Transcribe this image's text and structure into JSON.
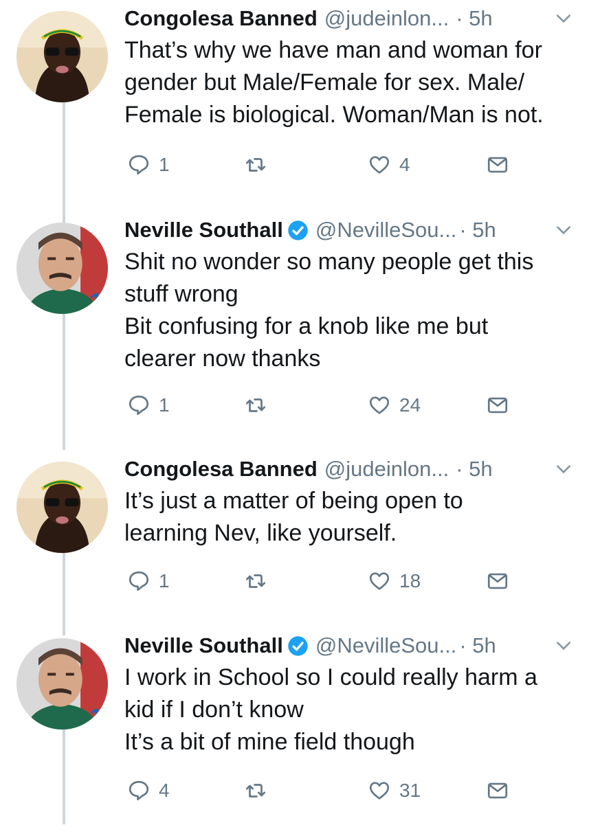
{
  "tweets": [
    {
      "display_name": "Congolesa Banned",
      "handle": "@judeinlon...",
      "time": "· 5h",
      "verified": false,
      "text_lines": [
        "That’s why we have man and woman for",
        "gender but Male/Female for sex. Male/",
        "Female is biological. Woman/Man is not."
      ],
      "reply_count": "1",
      "retweet_count": "",
      "like_count": "4"
    },
    {
      "display_name": "Neville Southall",
      "handle": "@NevilleSou...",
      "time": "· 5h",
      "verified": true,
      "text_lines": [
        "Shit no wonder so many people get this",
        "stuff wrong",
        "Bit confusing for a knob like me but",
        "clearer now thanks"
      ],
      "reply_count": "1",
      "retweet_count": "",
      "like_count": "24"
    },
    {
      "display_name": "Congolesa Banned",
      "handle": "@judeinlon...",
      "time": "· 5h",
      "verified": false,
      "text_lines": [
        "It’s just a matter of being open to",
        "learning Nev, like yourself."
      ],
      "reply_count": "1",
      "retweet_count": "",
      "like_count": "18"
    },
    {
      "display_name": "Neville Southall",
      "handle": "@NevilleSou...",
      "time": "· 5h",
      "verified": true,
      "text_lines": [
        "I work in School so I could really harm a",
        "kid if I don’t know",
        "It’s a bit of mine field though"
      ],
      "reply_count": "4",
      "retweet_count": "",
      "like_count": "31"
    }
  ],
  "icons": {
    "reply": "reply-icon",
    "retweet": "retweet-icon",
    "like": "like-icon",
    "dm": "direct-message-icon",
    "caret": "chevron-down-icon",
    "verified": "verified-badge-icon"
  },
  "colors": {
    "name": "#14171a",
    "secondary": "#657786",
    "verified": "#1da1f2",
    "thread_line": "#ccd6dd"
  }
}
